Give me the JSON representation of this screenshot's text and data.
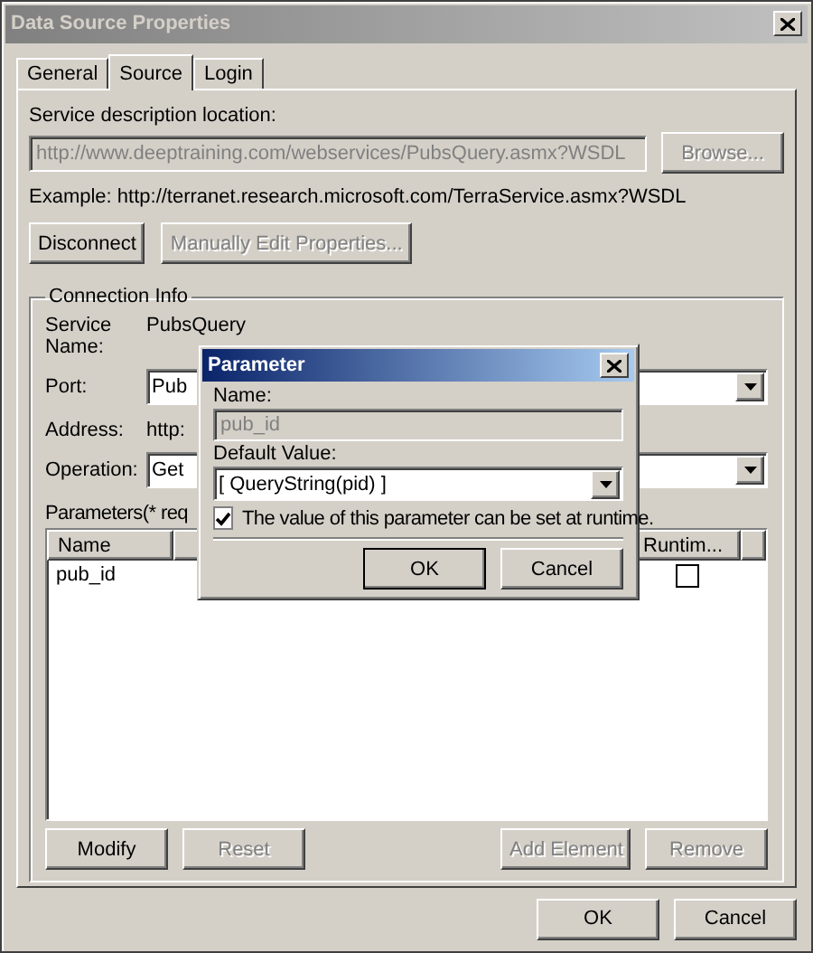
{
  "window": {
    "title": "Data Source Properties"
  },
  "tabs": [
    {
      "label": "General",
      "selected": false
    },
    {
      "label": "Source",
      "selected": true
    },
    {
      "label": "Login",
      "selected": false
    }
  ],
  "source": {
    "location_label": "Service description location:",
    "location_value": "http://www.deeptraining.com/webservices/PubsQuery.asmx?WSDL",
    "location_disabled": true,
    "browse": {
      "label": "Browse...",
      "disabled": true
    },
    "example": "Example: http://terranet.research.microsoft.com/TerraService.asmx?WSDL",
    "actions": [
      {
        "label": "Disconnect",
        "disabled": false
      },
      {
        "label": "Manually Edit Properties...",
        "disabled": true
      }
    ]
  },
  "connection": {
    "title": "Connection Info",
    "service_name_label": "Service Name:",
    "service_name": "PubsQuery",
    "port_label": "Port:",
    "port_value": "Pub",
    "address_label": "Address:",
    "address_value": "http:",
    "operation_label": "Operation:",
    "operation_value": "Get",
    "parameters_label": "Parameters(* req",
    "columns": [
      "Name",
      "Runtim..."
    ],
    "rows": [
      {
        "name": "pub_id",
        "runtime": false
      }
    ],
    "buttons": [
      {
        "label": "Modify",
        "disabled": false
      },
      {
        "label": "Reset",
        "disabled": true
      },
      {
        "label": "Add Element",
        "disabled": true
      },
      {
        "label": "Remove",
        "disabled": true
      }
    ]
  },
  "dialog": {
    "title": "Parameter",
    "name_label": "Name:",
    "name_value": "pub_id",
    "default_label": "Default Value:",
    "default_value": "[ QueryString(pid) ]",
    "runtime_label": "The value of this parameter can be set at runtime.",
    "runtime": true,
    "buttons": [
      {
        "label": "OK",
        "default": true
      },
      {
        "label": "Cancel",
        "default": false
      }
    ]
  },
  "buttons": [
    "OK",
    "Cancel"
  ]
}
